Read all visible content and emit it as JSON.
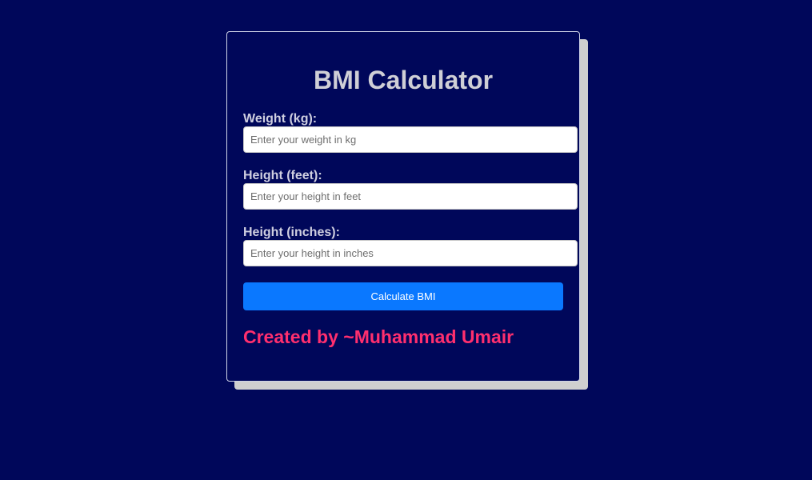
{
  "app": {
    "title": "BMI Calculator"
  },
  "form": {
    "weight": {
      "label": "Weight (kg):",
      "placeholder": "Enter your weight in kg",
      "value": ""
    },
    "height_feet": {
      "label": "Height (feet):",
      "placeholder": "Enter your height in feet",
      "value": ""
    },
    "height_inches": {
      "label": "Height (inches):",
      "placeholder": "Enter your height in inches",
      "value": ""
    },
    "submit_label": "Calculate BMI"
  },
  "footer": {
    "credit": "Created by ~Muhammad Umair"
  },
  "colors": {
    "background": "#00075a",
    "button": "#0a78ff",
    "credit": "#ff2f6e",
    "shadow": "#cfcfcf"
  }
}
